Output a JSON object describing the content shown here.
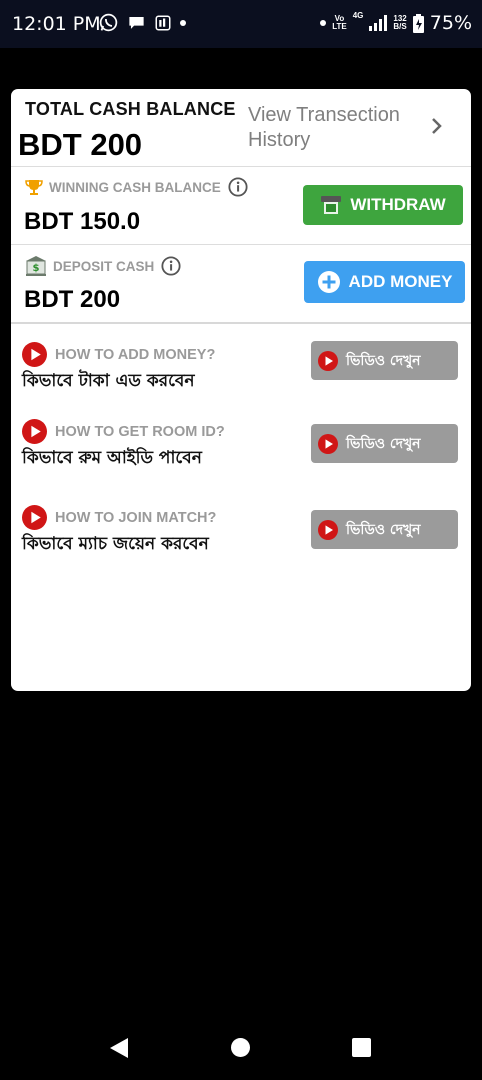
{
  "status": {
    "time": "12:01 PM",
    "volte_top": "Vo",
    "volte_bottom": "LTE",
    "network": "4G",
    "speed_top": "132",
    "speed_bottom": "B/S",
    "battery": "75%"
  },
  "wallet": {
    "total_label": "TOTAL CASH BALANCE",
    "total_value": "BDT 200",
    "history_link": "View Transection History"
  },
  "winning": {
    "label": "WINNING CASH BALANCE",
    "value": "BDT 150.0",
    "button": "WITHDRAW",
    "color": "#3ea53e"
  },
  "deposit": {
    "label": "DEPOSIT CASH",
    "value": "BDT 200",
    "button": "ADD MONEY",
    "color": "#3ea0f0"
  },
  "howto": [
    {
      "question": "HOW TO ADD MONEY?",
      "bangla": "কিভাবে টাকা এড করবেন",
      "button": "ভিডিও দেখুন"
    },
    {
      "question": "HOW TO GET ROOM ID?",
      "bangla": "কিভাবে রুম আইডি পাবেন",
      "button": "ভিডিও দেখুন"
    },
    {
      "question": "HOW TO JOIN MATCH?",
      "bangla": "কিভাবে ম্যাচ জয়েন করবেন",
      "button": "ভিডিও দেখুন"
    }
  ],
  "colors": {
    "play_red": "#d01616",
    "video_button": "#9b9b9b"
  }
}
